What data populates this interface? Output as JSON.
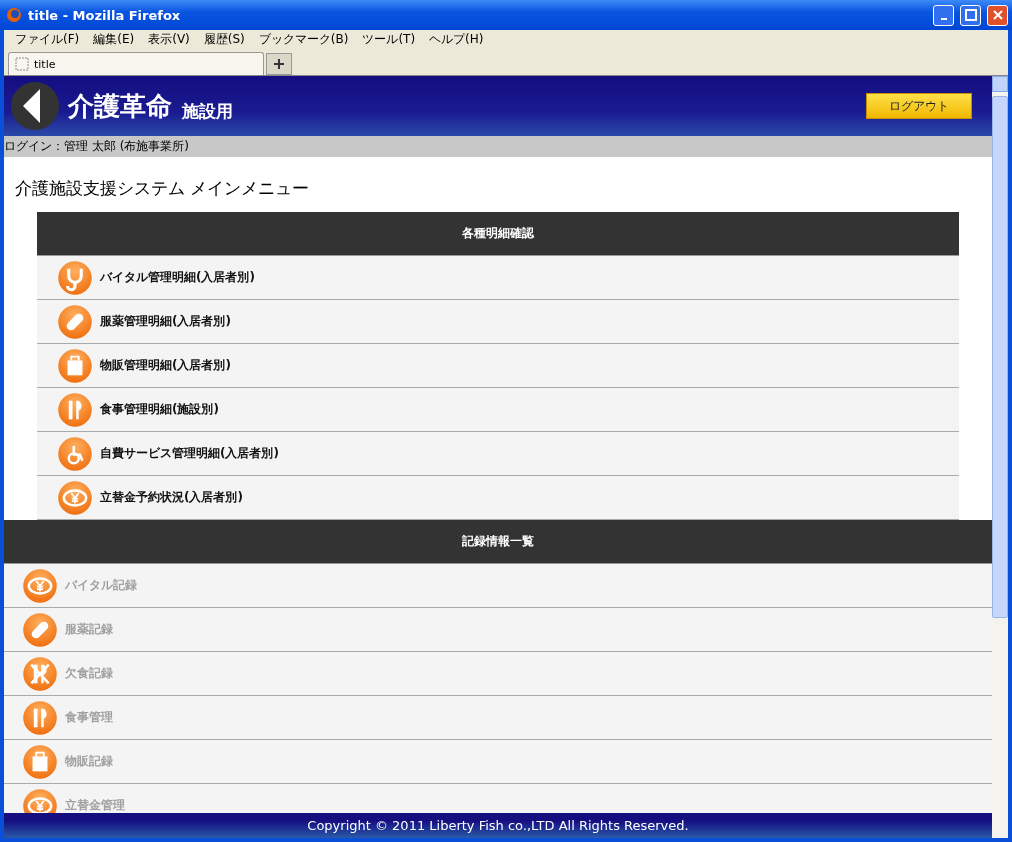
{
  "window": {
    "title": "title - Mozilla Firefox"
  },
  "menu": [
    "ファイル(F)",
    "編集(E)",
    "表示(V)",
    "履歴(S)",
    "ブックマーク(B)",
    "ツール(T)",
    "ヘルプ(H)"
  ],
  "tabs": [
    {
      "label": "title",
      "selected": true
    }
  ],
  "header": {
    "logo": "介護革命",
    "logo_sub": "施設用",
    "logout": "ログアウト"
  },
  "login_bar": "ログイン：管理 太郎 (布施事業所)",
  "page_title": "介護施設支援システム メインメニュー",
  "sections": [
    {
      "title": "各種明細確認",
      "items": [
        {
          "label": "バイタル管理明細(入居者別)",
          "kind": "stethoscope",
          "disabled": false
        },
        {
          "label": "服薬管理明細(入居者別)",
          "kind": "pill",
          "disabled": false
        },
        {
          "label": "物販管理明細(入居者別)",
          "kind": "bag",
          "disabled": false
        },
        {
          "label": "食事管理明細(施設別)",
          "kind": "utensils",
          "disabled": false
        },
        {
          "label": "自費サービス管理明細(入居者別)",
          "kind": "wheelchair",
          "disabled": false
        },
        {
          "label": "立替金予約状況(入居者別)",
          "kind": "yen",
          "disabled": false
        }
      ]
    },
    {
      "title": "記録情報一覧",
      "items": [
        {
          "label": "バイタル記録",
          "kind": "yen",
          "disabled": true
        },
        {
          "label": "服薬記録",
          "kind": "pill",
          "disabled": true
        },
        {
          "label": "欠食記録",
          "kind": "nofood",
          "disabled": true
        },
        {
          "label": "食事管理",
          "kind": "utensils",
          "disabled": true
        },
        {
          "label": "物販記録",
          "kind": "bag",
          "disabled": true
        },
        {
          "label": "立替金管理",
          "kind": "yen",
          "disabled": true
        }
      ]
    }
  ],
  "footer": "Copyright © 2011 Liberty Fish co.,LTD All Rights Reserved."
}
